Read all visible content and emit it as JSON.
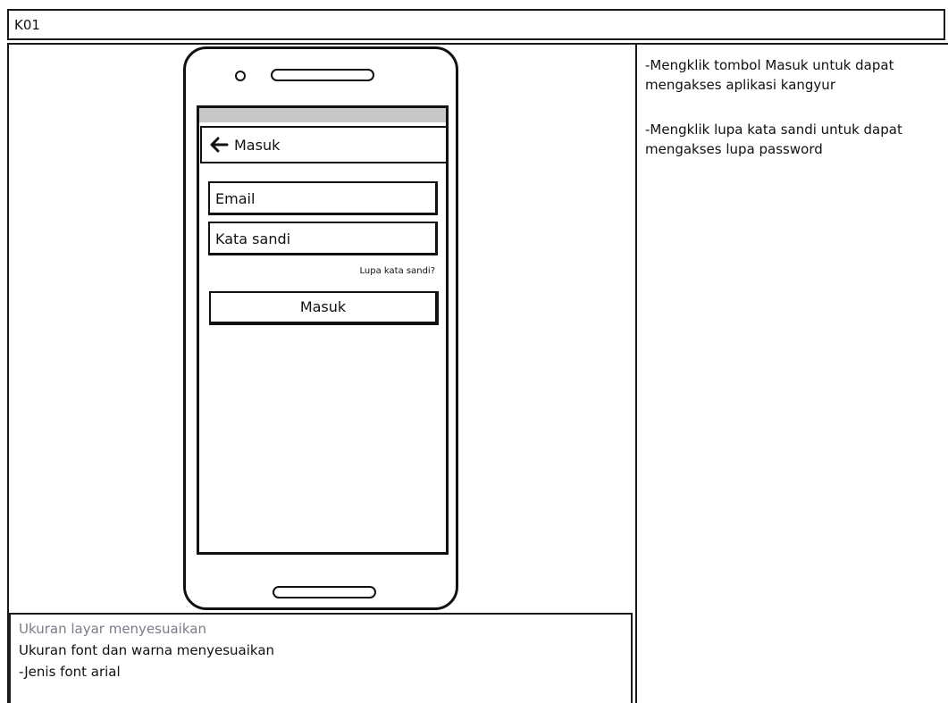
{
  "header": {
    "title": "K01"
  },
  "phone": {
    "app_bar": {
      "back_icon": "arrow-left-icon",
      "title": "Masuk"
    },
    "email": {
      "placeholder": "Email"
    },
    "password": {
      "placeholder": "Kata sandi"
    },
    "forgot_link": "Lupa kata sandi?",
    "login_button": "Masuk"
  },
  "notes": {
    "right": [
      "-Mengklik tombol Masuk untuk dapat mengakses aplikasi kangyur",
      "-Mengklik lupa kata sandi untuk dapat mengakses lupa password"
    ],
    "bottom": [
      "Ukuran layar menyesuaikan",
      "Ukuran font dan warna menyesuaikan",
      "-Jenis font arial"
    ]
  }
}
